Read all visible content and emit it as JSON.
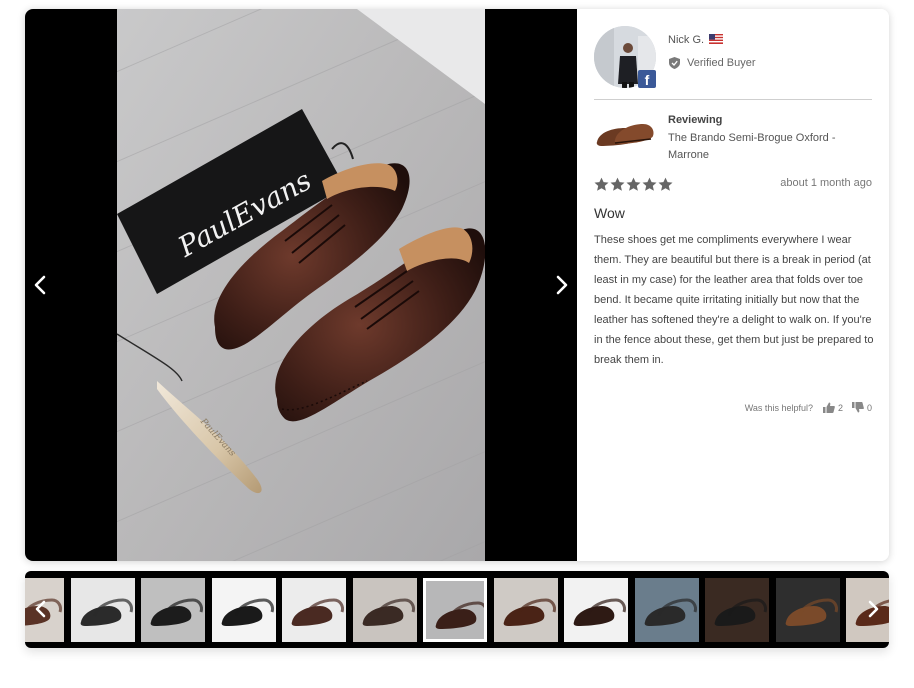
{
  "reviewer": {
    "name": "Nick G.",
    "country_flag": "us-flag-icon",
    "verified_label": "Verified Buyer",
    "social_badge": "f"
  },
  "product": {
    "reviewing_label": "Reviewing",
    "name": "The Brando Semi-Brogue Oxford - Marrone"
  },
  "review": {
    "rating": 5,
    "max_rating": 5,
    "date": "about 1 month ago",
    "title": "Wow",
    "body": "These shoes get me compliments everywhere I wear them. They are beautiful but there is a break in period (at least in my case) for the leather area that folds over toe bend. It became quite irritating initially but now that the leather has softened they're a delight to walk on. If you're in the fence about these, get them but just be prepared to break them in."
  },
  "helpful": {
    "label": "Was this helpful?",
    "up_count": "2",
    "down_count": "0"
  },
  "main_image": {
    "bag_text": "PaulEvans",
    "shoehorn_text": "PaulEvans"
  },
  "thumbnails": {
    "count": 13,
    "selected_index": 6
  },
  "colors": {
    "accent": "#3b5998",
    "star": "#666666",
    "viewer_bg": "#000000"
  }
}
